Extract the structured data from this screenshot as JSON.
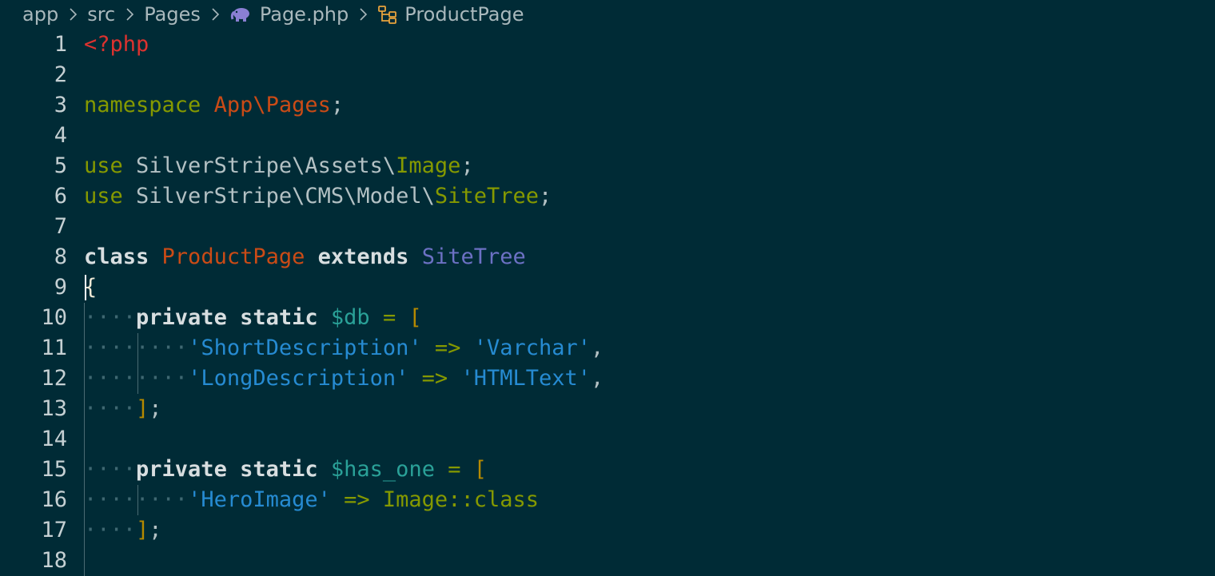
{
  "breadcrumb": {
    "items": [
      "app",
      "src",
      "Pages",
      "Page.php",
      "ProductPage"
    ],
    "file_icon": "php-elephant-icon",
    "symbol_icon": "class-icon",
    "separator_icon": "chevron-right-icon"
  },
  "colors": {
    "background": "#002b36",
    "keyword": "#859900",
    "string": "#268bd2",
    "class_name": "#cb4b16",
    "variable": "#2aa198",
    "php_tag": "#dc322f"
  },
  "editor": {
    "lines": [
      {
        "n": "1",
        "tokens": [
          {
            "t": "<?php",
            "c": "t-php"
          }
        ]
      },
      {
        "n": "2",
        "tokens": []
      },
      {
        "n": "3",
        "tokens": [
          {
            "t": "namespace",
            "c": "t-kw"
          },
          {
            "t": " ",
            "c": "t-plain"
          },
          {
            "t": "App\\Pages",
            "c": "t-ns"
          },
          {
            "t": ";",
            "c": "t-punct"
          }
        ]
      },
      {
        "n": "4",
        "tokens": []
      },
      {
        "n": "5",
        "tokens": [
          {
            "t": "use",
            "c": "t-kw"
          },
          {
            "t": " SilverStripe\\Assets\\",
            "c": "t-plain"
          },
          {
            "t": "Image",
            "c": "t-kw"
          },
          {
            "t": ";",
            "c": "t-punct"
          }
        ]
      },
      {
        "n": "6",
        "tokens": [
          {
            "t": "use",
            "c": "t-kw"
          },
          {
            "t": " SilverStripe\\CMS\\Model\\",
            "c": "t-plain"
          },
          {
            "t": "SiteTree",
            "c": "t-kw"
          },
          {
            "t": ";",
            "c": "t-punct"
          }
        ]
      },
      {
        "n": "7",
        "tokens": []
      },
      {
        "n": "8",
        "tokens": [
          {
            "t": "class",
            "c": "t-bold"
          },
          {
            "t": " ",
            "c": "t-plain"
          },
          {
            "t": "ProductPage",
            "c": "t-class"
          },
          {
            "t": " ",
            "c": "t-plain"
          },
          {
            "t": "extends",
            "c": "t-bold"
          },
          {
            "t": " ",
            "c": "t-plain"
          },
          {
            "t": "SiteTree",
            "c": "t-base"
          }
        ]
      },
      {
        "n": "9",
        "tokens": [
          {
            "t": "{",
            "c": "t-brace"
          }
        ]
      },
      {
        "n": "10",
        "tokens": [
          {
            "t": "····",
            "c": "t-ws"
          },
          {
            "t": "private",
            "c": "t-bold"
          },
          {
            "t": " ",
            "c": "t-plain"
          },
          {
            "t": "static",
            "c": "t-bold"
          },
          {
            "t": " ",
            "c": "t-plain"
          },
          {
            "t": "$db",
            "c": "t-var"
          },
          {
            "t": " = ",
            "c": "t-op"
          },
          {
            "t": "[",
            "c": "t-bracket"
          }
        ]
      },
      {
        "n": "11",
        "tokens": [
          {
            "t": "····",
            "c": "t-ws"
          },
          {
            "t": "····",
            "c": "t-ws"
          },
          {
            "t": "'ShortDescription'",
            "c": "t-str"
          },
          {
            "t": " => ",
            "c": "t-op"
          },
          {
            "t": "'Varchar'",
            "c": "t-str"
          },
          {
            "t": ",",
            "c": "t-punct"
          }
        ]
      },
      {
        "n": "12",
        "tokens": [
          {
            "t": "····",
            "c": "t-ws"
          },
          {
            "t": "····",
            "c": "t-ws"
          },
          {
            "t": "'LongDescription'",
            "c": "t-str"
          },
          {
            "t": " => ",
            "c": "t-op"
          },
          {
            "t": "'HTMLText'",
            "c": "t-str"
          },
          {
            "t": ",",
            "c": "t-punct"
          }
        ]
      },
      {
        "n": "13",
        "tokens": [
          {
            "t": "····",
            "c": "t-ws"
          },
          {
            "t": "]",
            "c": "t-bracket"
          },
          {
            "t": ";",
            "c": "t-punct"
          }
        ]
      },
      {
        "n": "14",
        "tokens": []
      },
      {
        "n": "15",
        "tokens": [
          {
            "t": "····",
            "c": "t-ws"
          },
          {
            "t": "private",
            "c": "t-bold"
          },
          {
            "t": " ",
            "c": "t-plain"
          },
          {
            "t": "static",
            "c": "t-bold"
          },
          {
            "t": " ",
            "c": "t-plain"
          },
          {
            "t": "$has_one",
            "c": "t-var"
          },
          {
            "t": " = ",
            "c": "t-op"
          },
          {
            "t": "[",
            "c": "t-bracket"
          }
        ]
      },
      {
        "n": "16",
        "tokens": [
          {
            "t": "····",
            "c": "t-ws"
          },
          {
            "t": "····",
            "c": "t-ws"
          },
          {
            "t": "'HeroImage'",
            "c": "t-str"
          },
          {
            "t": " => ",
            "c": "t-op"
          },
          {
            "t": "Image",
            "c": "t-kw"
          },
          {
            "t": "::",
            "c": "t-op"
          },
          {
            "t": "class",
            "c": "t-kw"
          }
        ]
      },
      {
        "n": "17",
        "tokens": [
          {
            "t": "····",
            "c": "t-ws"
          },
          {
            "t": "]",
            "c": "t-bracket"
          },
          {
            "t": ";",
            "c": "t-punct"
          }
        ]
      },
      {
        "n": "18",
        "tokens": []
      }
    ]
  }
}
